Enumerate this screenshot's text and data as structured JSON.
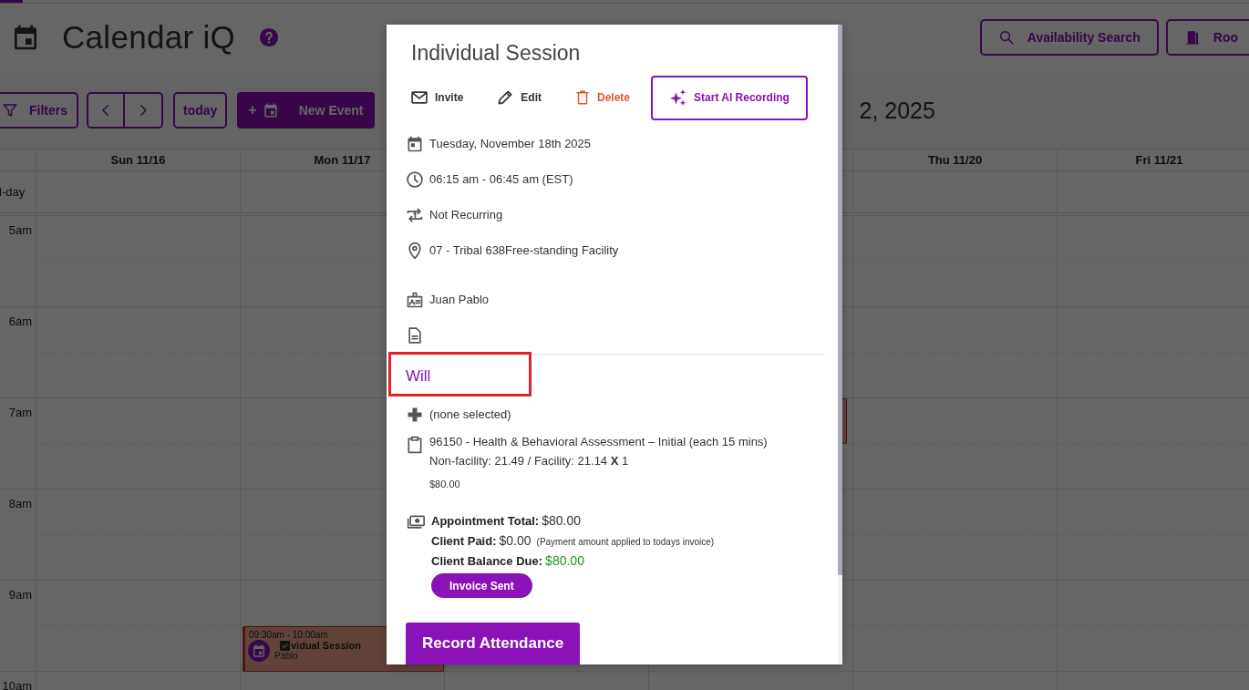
{
  "app": {
    "title": "Calendar iQ"
  },
  "header_buttons": [
    {
      "label": "Availability Search",
      "kind": "search"
    },
    {
      "label": "Roo",
      "kind": "room"
    }
  ],
  "toolbar": {
    "filters": "Filters",
    "today": "today",
    "new_event_prefix": "+",
    "new_event": "New Event",
    "range_title": "2, 2025"
  },
  "calendar": {
    "all_day_label": "l-day",
    "columns": [
      {
        "label": "Sun 11/16"
      },
      {
        "label": "Mon 11/17"
      },
      {},
      {},
      {
        "label": "Thu 11/20"
      },
      {
        "label": "Fri 11/21"
      }
    ],
    "hours": [
      "5am",
      "6am",
      "7am",
      "8am",
      "9am",
      "10am"
    ],
    "events": [
      {
        "kind": "appointment",
        "time": "09:30am - 10:00am",
        "title": "vidual Session",
        "client": "Pablo",
        "checked": true
      },
      {
        "kind": "appointment"
      }
    ]
  },
  "modal": {
    "title": "Individual Session",
    "actions": [
      {
        "label": "Invite",
        "kind": "invite"
      },
      {
        "label": "Edit",
        "kind": "edit"
      },
      {
        "label": "Delete",
        "kind": "delete"
      },
      {
        "label": "Start AI Recording",
        "kind": "ai"
      }
    ],
    "details": [
      {
        "kind": "date",
        "text": "Tuesday, November 18th 2025"
      },
      {
        "kind": "time",
        "text": "06:15 am - 06:45 am (EST)"
      },
      {
        "kind": "recurrence",
        "text": "Not Recurring"
      },
      {
        "kind": "location",
        "text": "07 - Tribal 638Free-standing Facility"
      },
      {
        "kind": "client",
        "text": "Juan Pablo"
      },
      {
        "kind": "notes"
      }
    ],
    "provider": "Will",
    "service": {
      "modifier": "(none selected)",
      "code": "96150 - Health & Behavioral Assessment – Initial (each 15 mins)",
      "rates": "Non-facility: 21.49 / Facility: 21.14 **X** 1",
      "price": "$80.00"
    },
    "totals": [
      {
        "label": "Appointment Total:",
        "value": "$80.00",
        "kind": "plain"
      },
      {
        "label": "Client Paid:",
        "value": "$0.00",
        "note": "(Payment amount applied to todays invoice)",
        "kind": "plain"
      },
      {
        "label": "Client Balance Due:",
        "value": "$80.00",
        "kind": "due"
      }
    ],
    "invoice_status": "Invoice Sent",
    "record_button": "Record Attendance"
  }
}
